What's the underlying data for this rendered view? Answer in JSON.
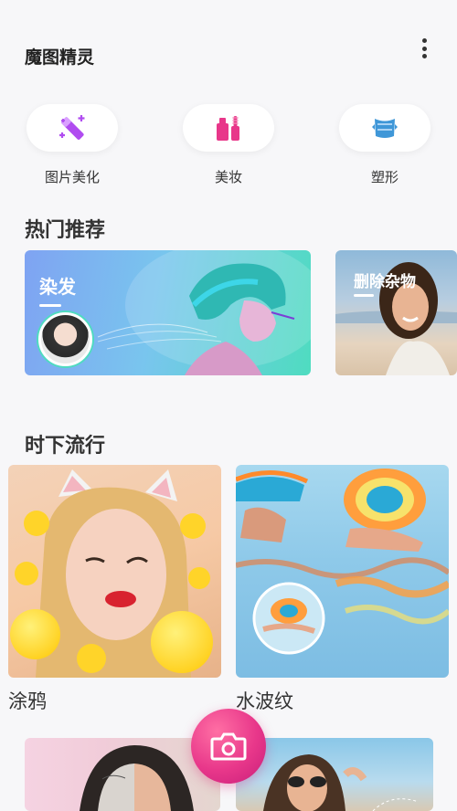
{
  "header": {
    "title": "魔图精灵"
  },
  "tools": [
    {
      "label": "图片美化",
      "icon": "magic-wand-icon"
    },
    {
      "label": "美妆",
      "icon": "makeup-icon"
    },
    {
      "label": "塑形",
      "icon": "body-shape-icon"
    }
  ],
  "hot": {
    "title": "热门推荐",
    "cards": [
      {
        "label": "染发"
      },
      {
        "label": "删除杂物"
      }
    ]
  },
  "trending": {
    "title": "时下流行",
    "items": [
      {
        "label": "涂鸦"
      },
      {
        "label": "水波纹"
      }
    ]
  },
  "colors": {
    "accent": "#e8378a",
    "tool_icon": "#b04cf0",
    "shape_icon": "#3f97d8"
  }
}
